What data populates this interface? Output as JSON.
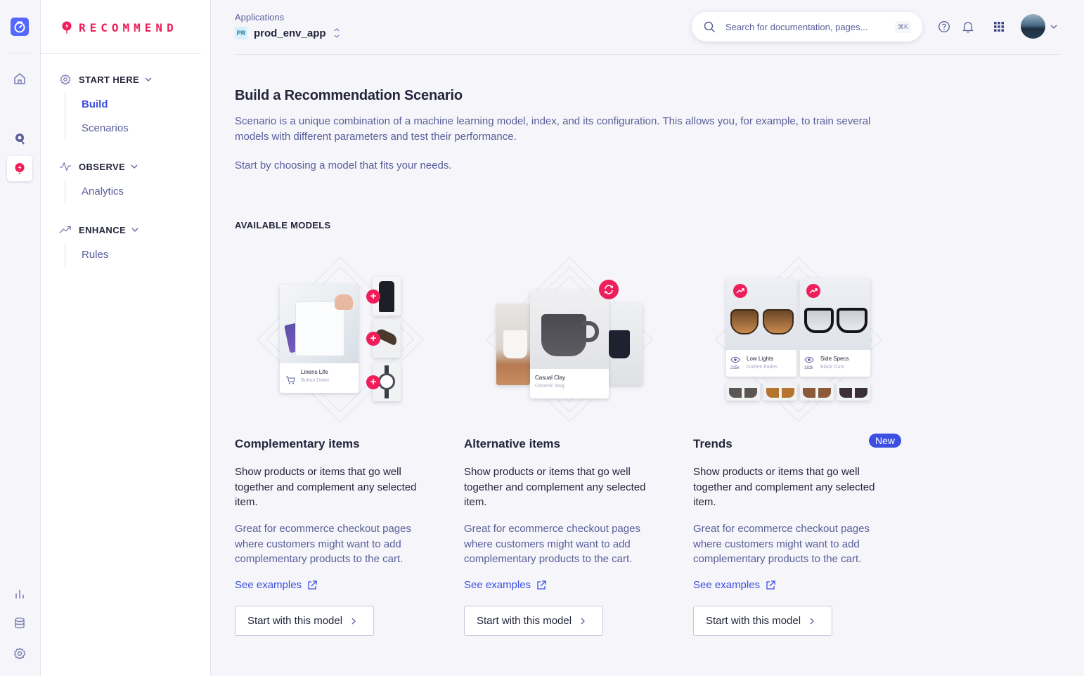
{
  "brand": {
    "name": "RECOMMEND",
    "accent": "#ef1d5a",
    "primary": "#3c4fe0"
  },
  "rail": {
    "icons": [
      "algolia-logo-icon",
      "home-icon",
      "search-pin-icon",
      "recommend-icon",
      "bar-chart-icon",
      "database-icon",
      "settings-icon"
    ]
  },
  "sidebar": {
    "sections": [
      {
        "label": "START HERE",
        "icon": "gear-icon",
        "items": [
          "Build",
          "Scenarios"
        ]
      },
      {
        "label": "OBSERVE",
        "icon": "pulse-icon",
        "items": [
          "Analytics"
        ]
      },
      {
        "label": "ENHANCE",
        "icon": "trend-icon",
        "items": [
          "Rules"
        ]
      }
    ],
    "active_item": "Build"
  },
  "header": {
    "apps_label": "Applications",
    "app_badge": "PR",
    "app_name": "prod_env_app",
    "search_placeholder": "Search for documentation, pages...",
    "search_shortcut": "⌘K"
  },
  "main": {
    "title": "Build a Recommendation Scenario",
    "description": "Scenario is a unique combination of a machine learning model, index, and its configuration. This allows you, for example, to train several models with different parameters and test their performance.",
    "start_text": "Start by choosing a model that fits your needs.",
    "available_label": "AVAILABLE MODELS"
  },
  "models": [
    {
      "title": "Complementary items",
      "badge": "",
      "description": "Show products or items that go well together and complement any selected item.",
      "note": "Great for ecommerce checkout pages where customers might want to add complementary products to the cart.",
      "link": "See examples",
      "button": "Start with this model",
      "product_name": "Linens Life",
      "product_sub": "Button Down"
    },
    {
      "title": "Alternative items",
      "badge": "",
      "description": "Show products or items that go well together and complement any selected item.",
      "note": "Great for ecommerce checkout pages where customers might want to add complementary products to the cart.",
      "link": "See examples",
      "button": "Start with this model",
      "product_name": "Casual Clay",
      "product_sub": "Ceramic Mug"
    },
    {
      "title": "Trends",
      "badge": "New",
      "description": "Show products or items that go well together and complement any selected item.",
      "note": "Great for ecommerce checkout pages where customers might want to add complementary products to the cart.",
      "link": "See examples",
      "button": "Start with this model",
      "product_name": "Low Lights",
      "product_sub": "Golden Fades",
      "product_count": "215k",
      "product2_name": "Side Specs",
      "product2_sub": "Black Outs",
      "product2_count": "182k"
    }
  ]
}
